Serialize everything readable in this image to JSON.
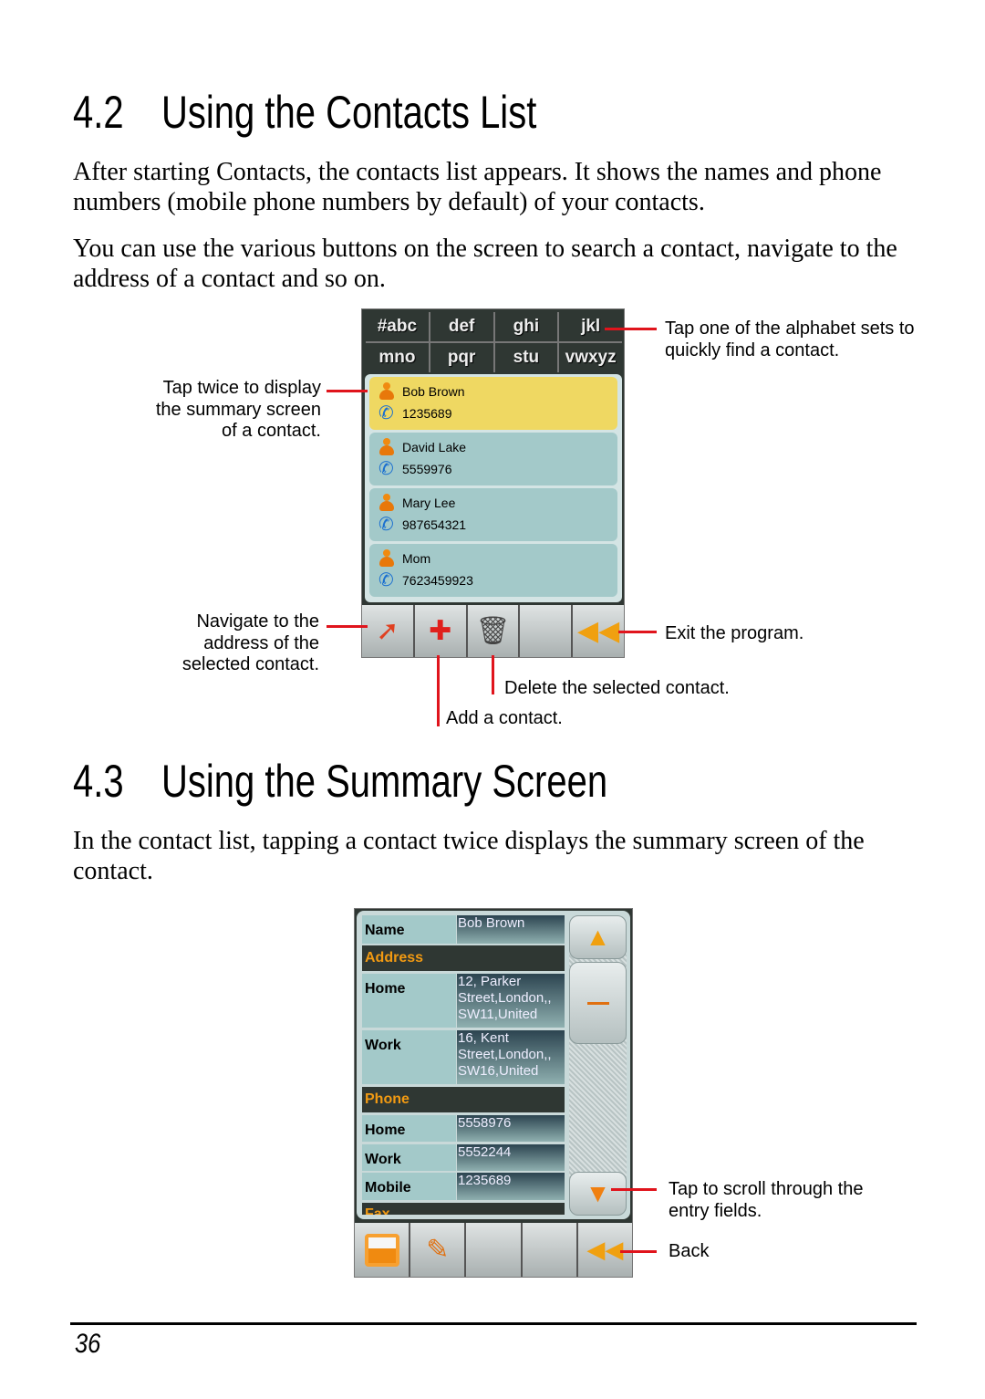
{
  "section42": {
    "number": "4.2",
    "title": "Using the Contacts List",
    "para1": "After starting Contacts, the contacts list appears. It shows the names and phone numbers (mobile phone numbers by default) of your contacts.",
    "para2": "You can use the various buttons on the screen to search a contact, navigate to the address of a contact and so on."
  },
  "contacts_screen": {
    "alphabet": [
      "#abc",
      "def",
      "ghi",
      "jkl",
      "mno",
      "pqr",
      "stu",
      "vwxyz"
    ],
    "contacts": [
      {
        "name": "Bob Brown",
        "phone": "1235689"
      },
      {
        "name": "David Lake",
        "phone": "5559976"
      },
      {
        "name": "Mary Lee",
        "phone": "987654321"
      },
      {
        "name": "Mom",
        "phone": "7623459923"
      }
    ],
    "toolbar_icons": [
      "navigate-icon",
      "add-contact-icon",
      "delete-icon",
      "empty",
      "exit-icon"
    ]
  },
  "annotations1": {
    "alphabet": "Tap one of the alphabet sets to\nquickly find a contact.",
    "tap_twice": "Tap twice to display\nthe summary screen\nof a contact.",
    "navigate": "Navigate to the\naddress of the\nselected contact.",
    "exit": "Exit the program.",
    "delete": "Delete the selected contact.",
    "add": "Add a contact."
  },
  "section43": {
    "number": "4.3",
    "title": "Using the Summary Screen",
    "para1": "In the contact list, tapping a contact twice displays the summary screen of the contact."
  },
  "summary_screen": {
    "name_label": "Name",
    "name_value": "Bob Brown",
    "address_header": "Address",
    "addr_home_label": "Home",
    "addr_home_value": "12, Parker Street,London,, SW11,United",
    "addr_work_label": "Work",
    "addr_work_value": "16, Kent Street,London,, SW16,United",
    "phone_header": "Phone",
    "ph_home_label": "Home",
    "ph_home_value": "5558976",
    "ph_work_label": "Work",
    "ph_work_value": "5552244",
    "ph_mobile_label": "Mobile",
    "ph_mobile_value": "1235689",
    "fax_header": "Fax",
    "accent": "#f29a12"
  },
  "annotations2": {
    "scroll": "Tap to scroll through the\nentry fields.",
    "back": "Back"
  },
  "footer": {
    "page": "36"
  }
}
